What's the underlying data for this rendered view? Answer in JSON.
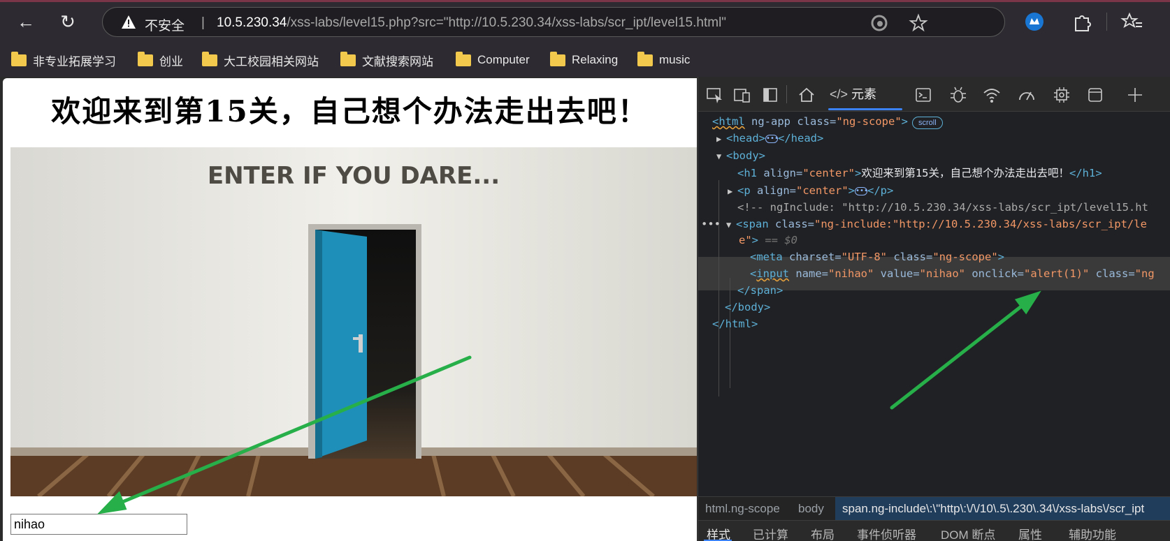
{
  "browser": {
    "nav": {
      "back_icon": "←",
      "reload_icon": "↻"
    },
    "address": {
      "insecure_label": "不安全",
      "separator": "|",
      "url_host": "10.5.230.34",
      "url_rest": "/xss-labs/level15.php?src=\"http://10.5.230.34/xss-labs/scr_ipt/level15.html\""
    },
    "bookmarks": [
      {
        "label": "非专业拓展学习"
      },
      {
        "label": "创业"
      },
      {
        "label": "大工校园相关网站"
      },
      {
        "label": "文献搜索网站"
      },
      {
        "label": "Computer"
      },
      {
        "label": "Relaxing"
      },
      {
        "label": "music"
      }
    ]
  },
  "page": {
    "heading": "欢迎来到第15关，自己想个办法走出去吧！",
    "image_caption": "ENTER IF YOU DARE...",
    "input_value": "nihao"
  },
  "devtools": {
    "elements_tab": "元素",
    "lines": {
      "l1_tag": "<html",
      "l1_attr": " ng-app class=",
      "l1_val": "\"ng-scope\"",
      "l1_end": ">",
      "l1_badge": "scroll",
      "l2_open": "<head>",
      "l2_close": "</head>",
      "l3": "<body>",
      "l4_tag": "<h1",
      "l4_attr": " align=",
      "l4_val": "\"center\"",
      "l4_gt": ">",
      "l4_text": "欢迎来到第15关，自己想个办法走出去吧！",
      "l4_close": "</h1>",
      "l5_tag": "<p",
      "l5_attr": " align=",
      "l5_val": "\"center\"",
      "l5_gt": ">",
      "l5_close": "</p>",
      "l6": "<!-- ngInclude: \"http://10.5.230.34/xss-labs/scr_ipt/level15.ht",
      "l7_tag": "<span",
      "l7_attr": " class=",
      "l7_val": "\"ng-include:\"http://10.5.230.34/xss-labs/scr_ipt/le",
      "l8_val": "e\"",
      "l8_gt": ">",
      "l8_eq": " == $0",
      "l9_tag": "<meta",
      "l9_attr1": " charset=",
      "l9_val1": "\"UTF-8\"",
      "l9_attr2": " class=",
      "l9_val2": "\"ng-scope\"",
      "l9_gt": ">",
      "l10_tag_lt": "<",
      "l10_tag": "input",
      "l10_attr1": " name=",
      "l10_val1": "\"nihao\"",
      "l10_attr2": " value=",
      "l10_val2": "\"nihao\"",
      "l10_attr3": " onclick=",
      "l10_val3": "\"alert(1)\"",
      "l10_attr4": " class=",
      "l10_val4": "\"ng",
      "l11": "</span>",
      "l12": "</body>",
      "l13": "</html>",
      "gutter_dots": "•••"
    },
    "breadcrumbs": {
      "c1": "html.ng-scope",
      "c2": "body",
      "c3": "span.ng-include\\:\\\"http\\:\\/\\/10\\.5\\.230\\.34\\/xss-labs\\/scr_ipt"
    },
    "bottom_tabs": [
      "样式",
      "已计算",
      "布局",
      "事件侦听器",
      "DOM 断点",
      "属性",
      "辅助功能"
    ]
  },
  "colors": {
    "arrow": "#27b04a",
    "door": "#1e8fb8",
    "tab_accent": "#3b82f6"
  }
}
